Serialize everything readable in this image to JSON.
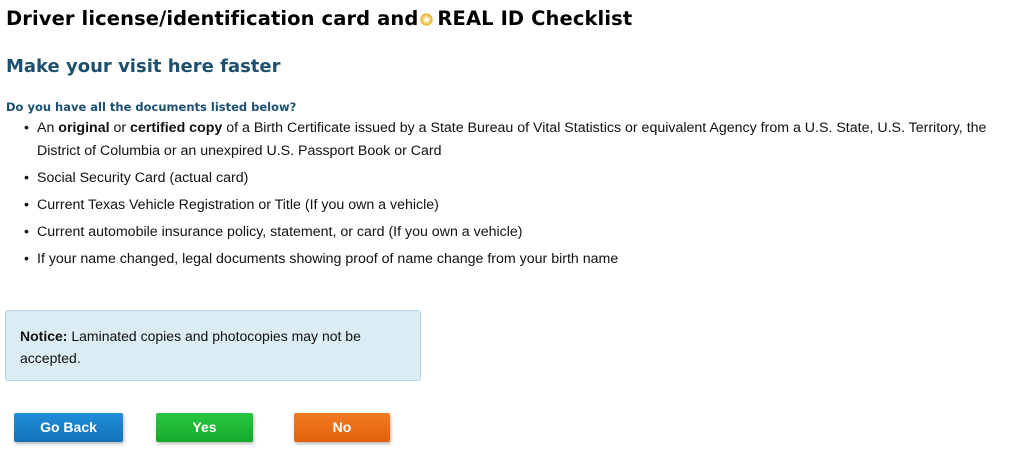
{
  "header": {
    "title_part1": "Driver license/identification card and",
    "title_part2": "REAL ID Checklist",
    "star_icon": "real-id-star-icon",
    "star_color": "#e8b63a"
  },
  "subtitle": "Make your visit here faster",
  "question": "Do you have all the documents listed below?",
  "documents": [
    {
      "pre": "An ",
      "bold1": "original",
      "mid": " or ",
      "bold2": "certified copy",
      "post": " of a Birth Certificate issued by a State Bureau of Vital Statistics or equivalent Agency from a U.S. State, U.S. Territory, the District of Columbia or an unexpired U.S. Passport Book or Card"
    },
    {
      "text": "Social Security Card (actual card)"
    },
    {
      "text": "Current Texas Vehicle Registration or Title (If you own a vehicle)"
    },
    {
      "text": "Current automobile insurance policy, statement, or card (If you own a vehicle)"
    },
    {
      "text": "If your name changed, legal documents showing proof of name change from your birth name"
    }
  ],
  "notice": {
    "label": "Notice:",
    "text": " Laminated copies and photocopies may not be accepted."
  },
  "buttons": {
    "back_label": "Go Back",
    "yes_label": "Yes",
    "no_label": "No"
  },
  "colors": {
    "heading": "#1d4f6e",
    "notice_bg": "#dcecf4",
    "back_button": "#1a7ec7",
    "yes_button": "#1db534",
    "no_button": "#ea6d16"
  }
}
